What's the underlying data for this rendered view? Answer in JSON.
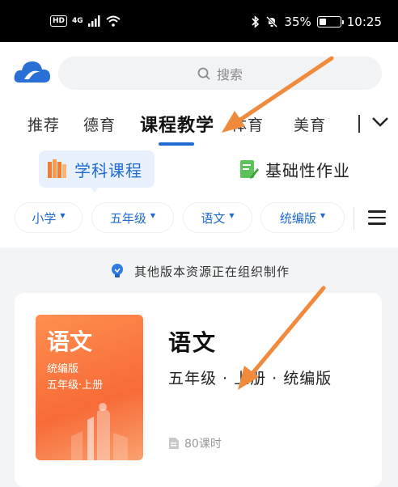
{
  "status_bar": {
    "hd": "HD",
    "network": "4G",
    "battery_text": "35%",
    "battery_level": 0.35,
    "time": "10:25"
  },
  "search": {
    "placeholder": "搜索"
  },
  "tabs": [
    {
      "label": "推荐",
      "active": false
    },
    {
      "label": "德育",
      "active": false
    },
    {
      "label": "课程教学",
      "active": true
    },
    {
      "label": "体育",
      "active": false
    },
    {
      "label": "美育",
      "active": false
    }
  ],
  "subtabs": [
    {
      "label": "学科课程",
      "active": true
    },
    {
      "label": "基础性作业",
      "active": false
    }
  ],
  "filters": [
    {
      "label": "小学"
    },
    {
      "label": "五年级"
    },
    {
      "label": "语文"
    },
    {
      "label": "统编版"
    }
  ],
  "notice": "其他版本资源正在组织制作",
  "course": {
    "cover_title": "语文",
    "cover_edition": "统编版",
    "cover_grade": "五年级·上册",
    "title": "语文",
    "meta": "五年级 · 上册 · 统编版",
    "lessons": "80课时"
  },
  "colors": {
    "accent": "#1f6bd1",
    "annotation_arrow": "#f08a3c",
    "cover": "#f86b37"
  }
}
